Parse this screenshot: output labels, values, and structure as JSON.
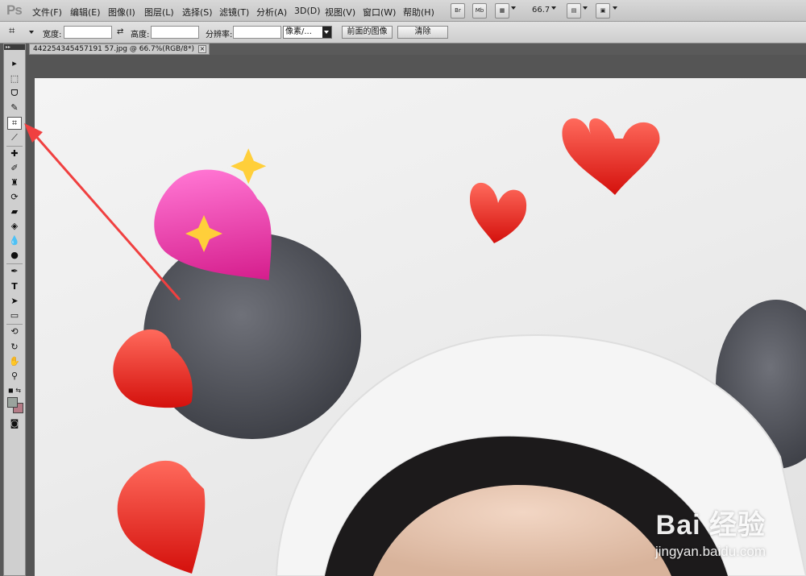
{
  "app": {
    "logo": "Ps"
  },
  "menu": [
    "文件(F)",
    "编辑(E)",
    "图像(I)",
    "图层(L)",
    "选择(S)",
    "滤镜(T)",
    "分析(A)",
    "3D(D)",
    "视图(V)",
    "窗口(W)",
    "帮助(H)"
  ],
  "appbar": {
    "br_label": "Br",
    "mb_label": "Mb",
    "zoom": "66.7"
  },
  "options": {
    "width_label": "宽度:",
    "height_label": "高度:",
    "resolution_label": "分辨率:",
    "unit_value": "像素/...",
    "front_image_button": "前面的图像",
    "clear_button": "清除"
  },
  "document": {
    "tab_title": "442254345457191 57.jpg @ 66.7%(RGB/8*)",
    "close": "×"
  },
  "watermark": {
    "brand": "Bai 经验",
    "url": "jingyan.baidu.com"
  },
  "colors": {
    "accent_arrow": "#f04040",
    "foreground_swatch": "#9aa39d",
    "background_swatch": "#b47b86"
  }
}
